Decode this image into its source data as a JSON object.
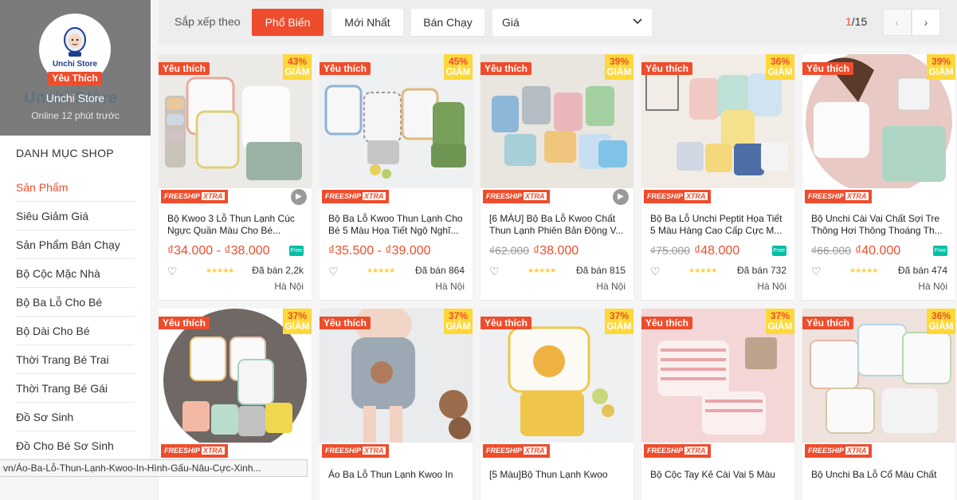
{
  "shop": {
    "logo_text": "Unchi Store",
    "fav_badge": "Yêu Thích",
    "name": "Unchi Store",
    "ghost_name": "Unchi Store",
    "online": "Online 12 phút trước"
  },
  "categories": {
    "title": "DANH MỤC SHOP",
    "items": [
      "Sản Phẩm",
      "Siêu Giảm Giá",
      "Sản Phẩm Bán Chạy",
      "Bộ Cộc Mặc Nhà",
      "Bộ Ba Lỗ Cho Bé",
      "Bộ Dài Cho Bé",
      "Thời Trang Bé Trai",
      "Thời Trang Bé Gái",
      "Đồ Sơ Sinh",
      "Đồ Cho Bé Sơ Sinh"
    ]
  },
  "statusbar": "vn/Áo-Ba-Lỗ-Thun-Lạnh-Kwoo-In-Hình-Gấu-Nâu-Cực-Xinh...",
  "sort": {
    "label": "Sắp xếp theo",
    "popular": "Phổ Biến",
    "newest": "Mới Nhất",
    "bestseller": "Bán Chạy",
    "price": "Giá",
    "page_current": "1",
    "page_total": "/15",
    "prev": "‹",
    "next": "›"
  },
  "colors": {
    "accent": "#ee4d2d",
    "badge_yellow": "#ffd839"
  },
  "products": [
    {
      "fav": "Yêu thích",
      "discount": "43%",
      "off": "GIẢM",
      "freeship": "FREESHIP",
      "xtra": "XTRA",
      "video": true,
      "name": "Bộ Kwoo 3 Lỗ Thun Lạnh Cúc Ngực Quần Màu Cho Bé...",
      "old_price": "",
      "price": "₫34.000 - ₫38.000",
      "sold": "Đã bán 2,2k",
      "location": "Hà Nội",
      "stars": "★★★★★"
    },
    {
      "fav": "Yêu thích",
      "discount": "45%",
      "off": "GIẢM",
      "freeship": "FREESHIP",
      "xtra": "XTRA",
      "video": false,
      "name": "Bộ Ba Lỗ Kwoo Thun Lạnh Cho Bé 5 Màu Họa Tiết Ngộ Nghĩ...",
      "old_price": "",
      "price": "₫35.500 - ₫39.000",
      "sold": "Đã bán 864",
      "location": "Hà Nội",
      "stars": "★★★★★"
    },
    {
      "fav": "Yêu thích",
      "discount": "39%",
      "off": "GIẢM",
      "freeship": "FREESHIP",
      "xtra": "XTRA",
      "video": true,
      "name": "[6 MÀU] Bộ Ba Lỗ Kwoo Chất Thun Lạnh Phiên Bản Động V...",
      "old_price": "₫62.000",
      "price": "₫38.000",
      "sold": "Đã bán 815",
      "location": "Hà Nội",
      "stars": "★★★★★"
    },
    {
      "fav": "Yêu thích",
      "discount": "36%",
      "off": "GIẢM",
      "freeship": "FREESHIP",
      "xtra": "XTRA",
      "video": false,
      "name": "Bộ Ba Lỗ Unchi Peptit Họa Tiết 5 Màu Hàng Cao Cấp Cực M...",
      "old_price": "₫75.000",
      "price": "₫48.000",
      "sold": "Đã bán 732",
      "location": "Hà Nội",
      "stars": "★★★★★"
    },
    {
      "fav": "Yêu thích",
      "discount": "39%",
      "off": "GIẢM",
      "freeship": "FREESHIP",
      "xtra": "XTRA",
      "video": false,
      "name": "Bộ Unchi Cài Vai Chất Sợi Tre Thông Hơi Thông Thoáng Th...",
      "old_price": "₫66.000",
      "price": "₫40.000",
      "sold": "Đã bán 474",
      "location": "Hà Nội",
      "stars": "★★★★★"
    },
    {
      "fav": "Yêu thích",
      "discount": "37%",
      "off": "GIẢM",
      "freeship": "FREESHIP",
      "xtra": "XTRA",
      "name": "",
      "price": ""
    },
    {
      "fav": "Yêu thích",
      "discount": "37%",
      "off": "GIẢM",
      "freeship": "FREESHIP",
      "xtra": "XTRA",
      "name": "Áo Ba Lỗ Thun Lạnh Kwoo In",
      "price": ""
    },
    {
      "fav": "Yêu thích",
      "discount": "37%",
      "off": "GIẢM",
      "freeship": "FREESHIP",
      "xtra": "XTRA",
      "name": "[5 Màu]Bộ Thun Lạnh Kwoo",
      "price": ""
    },
    {
      "fav": "Yêu thích",
      "discount": "37%",
      "off": "GIẢM",
      "freeship": "FREESHIP",
      "xtra": "XTRA",
      "name": "Bộ Cộc Tay Kẻ Cài Vai 5 Màu",
      "price": ""
    },
    {
      "fav": "Yêu thích",
      "discount": "36%",
      "off": "GIẢM",
      "freeship": "FREESHIP",
      "xtra": "XTRA",
      "name": "Bộ Unchi Ba Lỗ Cổ Màu Chất",
      "price": ""
    }
  ]
}
